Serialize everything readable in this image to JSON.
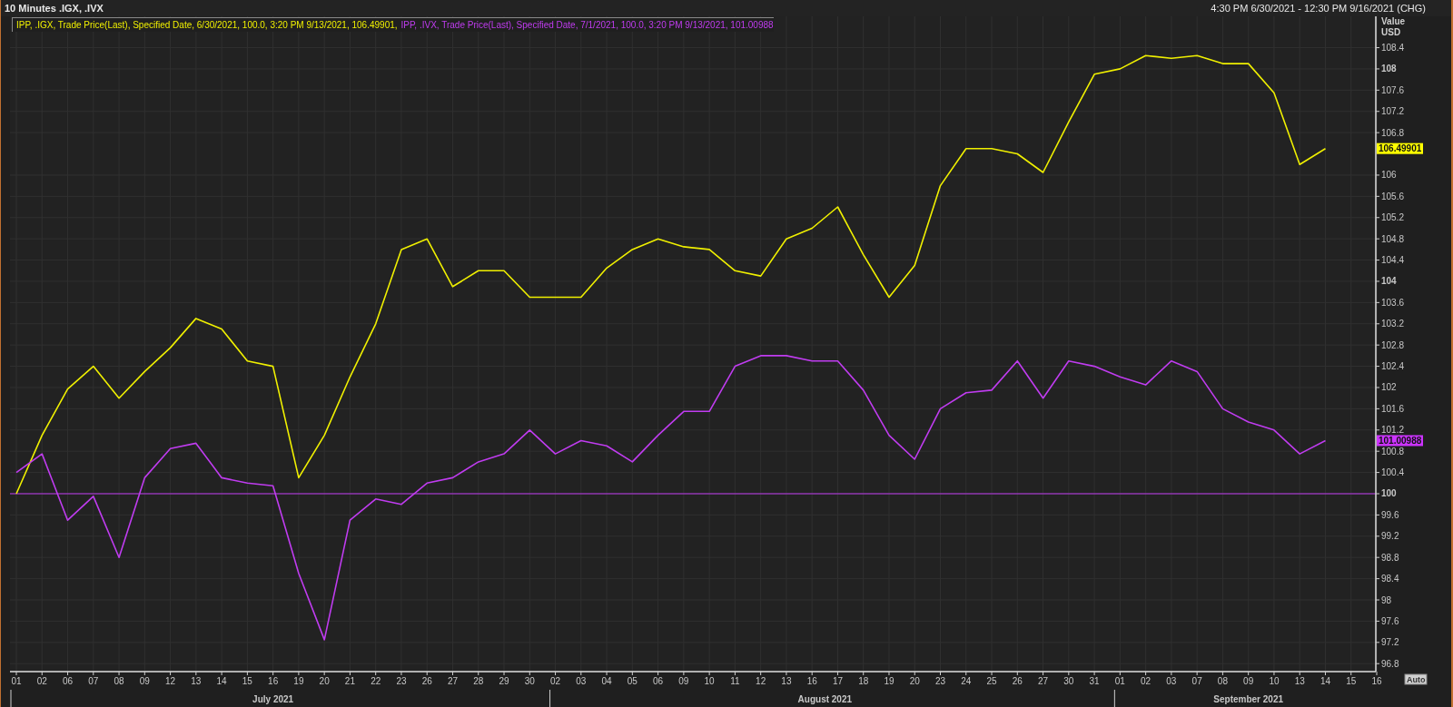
{
  "window": {
    "title": "10 Minutes .IGX, .IVX",
    "date_range": "4:30 PM 6/30/2021 - 12:30 PM 9/16/2021 (CHG)"
  },
  "legend": [
    {
      "text": "IPP, .IGX, Trade Price(Last), Specified Date, 6/30/2021, 100.0, 3:20 PM 9/13/2021, 106.49901,",
      "color": "#f0f000"
    },
    {
      "text": "IPP, .IVX, Trade Price(Last), Specified Date, 7/1/2021, 100.0, 3:20 PM 9/13/2021, 101.00988",
      "color": "#c03cf0"
    }
  ],
  "value_axis": {
    "title": "Value",
    "unit": "USD"
  },
  "axis_badges": [
    {
      "text": "106.49901",
      "color": "#ffff00"
    },
    {
      "text": "101.00988",
      "color": "#cc33ff"
    }
  ],
  "auto_button": "Auto",
  "months": [
    "July 2021",
    "August 2021",
    "September 2021"
  ],
  "chart_data": {
    "type": "line",
    "grid": true,
    "categories": [
      "01",
      "02",
      "06",
      "07",
      "08",
      "09",
      "12",
      "13",
      "14",
      "15",
      "16",
      "19",
      "20",
      "21",
      "22",
      "23",
      "26",
      "27",
      "28",
      "29",
      "30",
      "02",
      "03",
      "04",
      "05",
      "06",
      "09",
      "10",
      "11",
      "12",
      "13",
      "16",
      "17",
      "18",
      "19",
      "20",
      "23",
      "24",
      "25",
      "26",
      "27",
      "30",
      "31",
      "01",
      "02",
      "03",
      "07",
      "08",
      "09",
      "10",
      "13",
      "14",
      "15",
      "16"
    ],
    "ylim": [
      96.65,
      108.99
    ],
    "yticks": [
      96.8,
      97.2,
      97.6,
      98,
      98.4,
      98.8,
      99.2,
      99.6,
      100,
      100.4,
      100.8,
      101.2,
      101.6,
      102,
      102.4,
      102.8,
      103.2,
      103.6,
      104,
      104.4,
      104.8,
      105.2,
      105.6,
      106,
      106.8,
      107.2,
      107.6,
      108,
      108.4
    ],
    "series": [
      {
        "color": "#f0f000",
        "values": [
          100.0,
          101.1,
          101.97,
          102.4,
          101.8,
          102.3,
          102.75,
          103.3,
          103.1,
          102.5,
          102.4,
          100.3,
          101.1,
          102.2,
          103.2,
          104.6,
          104.8,
          103.9,
          104.2,
          104.2,
          103.7,
          103.7,
          103.7,
          104.25,
          104.6,
          104.8,
          104.65,
          104.6,
          104.2,
          104.1,
          104.8,
          105.0,
          105.4,
          104.5,
          103.7,
          104.3,
          105.8,
          106.5,
          106.5,
          106.4,
          106.05,
          107.0,
          107.9,
          108.0,
          108.25,
          108.2,
          108.25,
          108.1,
          108.1,
          107.55,
          106.2,
          106.5,
          null,
          null
        ]
      },
      {
        "color": "#c03cf0",
        "values": [
          100.4,
          100.75,
          99.5,
          99.95,
          98.8,
          100.3,
          100.85,
          100.95,
          100.3,
          100.2,
          100.15,
          98.5,
          97.25,
          99.5,
          99.9,
          99.8,
          100.2,
          100.3,
          100.6,
          100.75,
          101.2,
          100.75,
          101.0,
          100.9,
          100.6,
          101.1,
          101.55,
          101.55,
          102.4,
          102.6,
          102.6,
          102.5,
          102.5,
          101.95,
          101.1,
          100.65,
          101.6,
          101.9,
          101.95,
          102.5,
          101.8,
          102.5,
          102.4,
          102.2,
          102.05,
          102.5,
          102.3,
          101.6,
          101.35,
          101.2,
          100.75,
          101.0,
          null,
          null
        ]
      }
    ],
    "ref_lines": [
      {
        "axis": "y",
        "value": 100,
        "color": "#c03cf0"
      }
    ]
  }
}
